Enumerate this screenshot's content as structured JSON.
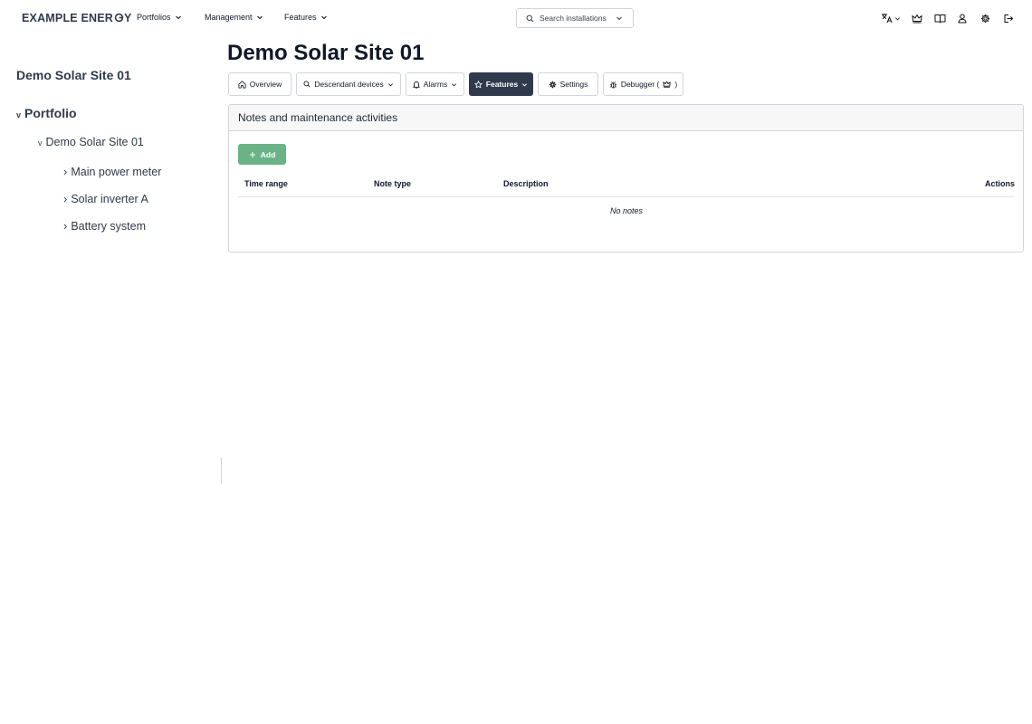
{
  "brand": {
    "name_prefix": "EXAMPLE ENER",
    "name_suffix": "Y"
  },
  "nav": {
    "menus": [
      {
        "label": "Portfolios"
      },
      {
        "label": "Management"
      },
      {
        "label": "Features"
      }
    ],
    "search": {
      "placeholder": "Search installations"
    },
    "icons": [
      "translate-icon",
      "crown-icon",
      "book-icon",
      "user-icon",
      "gear-icon",
      "logout-icon"
    ]
  },
  "sidebar": {
    "title": "Demo Solar Site 01",
    "tree": {
      "portfolio": {
        "toggle": "v",
        "label": "Portfolio"
      },
      "site": {
        "toggle": "v",
        "label": "Demo Solar Site 01"
      },
      "devices": [
        {
          "toggle": "›",
          "label": "Main power meter"
        },
        {
          "toggle": "›",
          "label": "Solar inverter A"
        },
        {
          "toggle": "›",
          "label": "Battery system"
        }
      ]
    }
  },
  "main": {
    "title": "Demo Solar Site 01",
    "tabs": [
      {
        "label": "Overview",
        "icon": "home-icon"
      },
      {
        "label": "Descendant devices",
        "icon": "search-icon",
        "dropdown": true
      },
      {
        "label": "Alarms",
        "icon": "bell-icon",
        "dropdown": true
      },
      {
        "label": "Features",
        "icon": "star-icon",
        "dropdown": true,
        "active": true
      },
      {
        "label": "Settings",
        "icon": "gear-icon"
      },
      {
        "label": "Debugger (",
        "label_end": ")",
        "icon": "bug-icon"
      }
    ],
    "notes_panel": {
      "title": "Notes and maintenance activities",
      "add_label": "Add",
      "columns": [
        "Time range",
        "Note type",
        "Description",
        "Actions"
      ],
      "empty_text": "No notes"
    }
  },
  "colors": {
    "brand_text": "#2f3b4c",
    "active_tab": "#2f3b4c",
    "add_button": "#6ab386",
    "border": "#d1d5db"
  }
}
